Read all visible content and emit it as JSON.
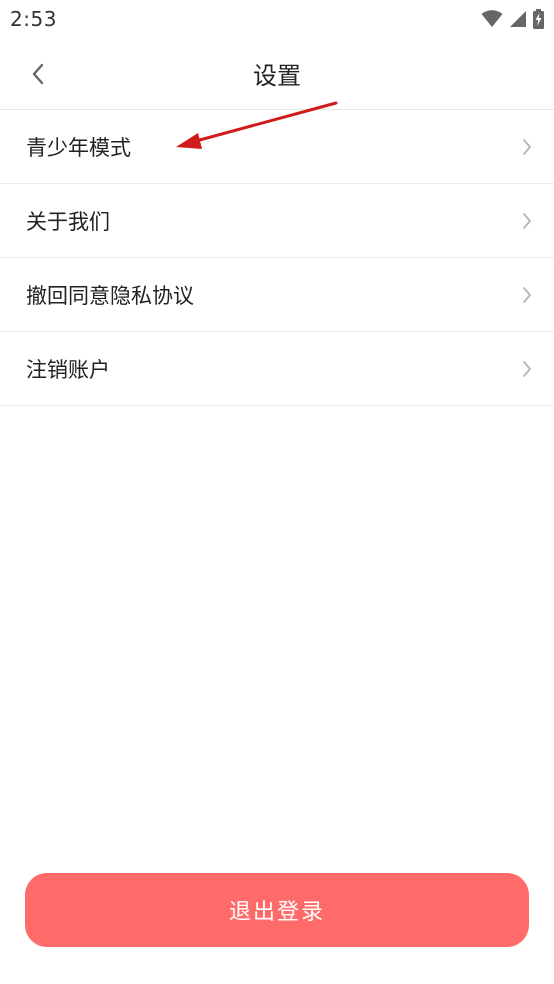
{
  "status_bar": {
    "time": "2:53",
    "icons": [
      "wifi-icon",
      "cell-signal-icon",
      "battery-charging-icon"
    ]
  },
  "header": {
    "title": "设置",
    "back_icon": "chevron-left-icon"
  },
  "settings": {
    "items": [
      {
        "label": "青少年模式"
      },
      {
        "label": "关于我们"
      },
      {
        "label": "撤回同意隐私协议"
      },
      {
        "label": "注销账户"
      }
    ]
  },
  "footer": {
    "logout_label": "退出登录"
  },
  "colors": {
    "accent": "#ff6b68",
    "annotation": "#d11a1a",
    "divider": "#ebebeb",
    "chevron": "#b5b5b5"
  }
}
